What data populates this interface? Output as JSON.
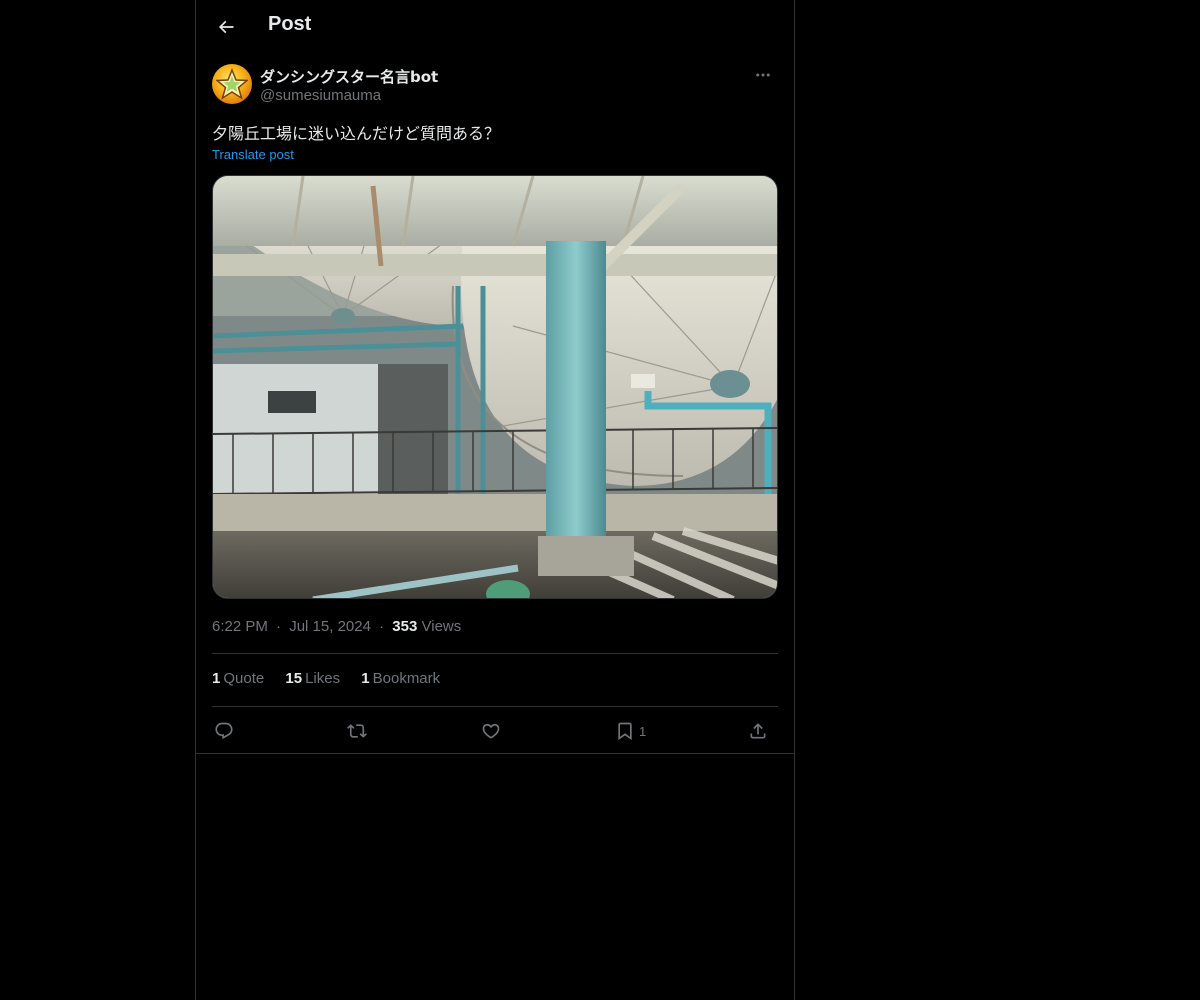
{
  "header": {
    "title": "Post",
    "back_icon": "arrow-left-icon"
  },
  "author": {
    "display_name": "ダンシングスター名言bot",
    "handle": "@sumesiumauma",
    "avatar_icon": "star-avatar",
    "more_icon": "more-horizontal-icon"
  },
  "post": {
    "text": "夕陽丘工場に迷い込んだけど質問ある？",
    "translate_label": "Translate post",
    "media_description": "photo"
  },
  "meta": {
    "time": "6:22 PM",
    "separator": "·",
    "date": "Jul 15, 2024",
    "views_count": "353",
    "views_label": "Views"
  },
  "stats": [
    {
      "count": "1",
      "label": "Quote"
    },
    {
      "count": "15",
      "label": "Likes"
    },
    {
      "count": "1",
      "label": "Bookmark"
    }
  ],
  "actions": {
    "reply_icon": "reply-icon",
    "repost_icon": "repost-icon",
    "like_icon": "heart-icon",
    "bookmark_icon": "bookmark-icon",
    "bookmark_count": "1",
    "share_icon": "share-icon"
  },
  "colors": {
    "background": "#000000",
    "text": "#e7e9ea",
    "muted": "#71767b",
    "accent": "#1d9bf0",
    "border": "#2f3336"
  }
}
